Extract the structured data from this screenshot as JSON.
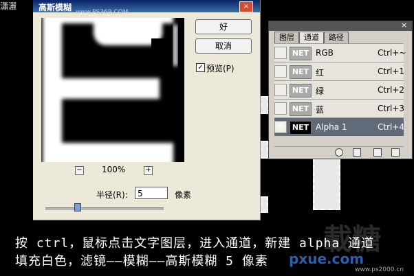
{
  "top_left_text": "瀟灑",
  "dialog": {
    "title": "高斯模糊",
    "title_watermark": "www.PS369.COM",
    "ok_label": "好",
    "cancel_label": "取消",
    "preview_label": "预览(P)",
    "preview_checked": true,
    "preview_checkmark": "✓",
    "zoom_minus": "−",
    "zoom_plus": "+",
    "zoom_value": "100%",
    "radius_label": "半径(R):",
    "radius_value": "5",
    "radius_unit": "像素",
    "close_glyph": "×",
    "slider_fraction": 0.27
  },
  "channels_panel": {
    "tabs": [
      "图层",
      "通道",
      "路径"
    ],
    "active_tab": 1,
    "close_glyph": "×",
    "rows": [
      {
        "thumb": "NET",
        "label": "RGB",
        "shortcut": "Ctrl+~",
        "visible": false,
        "selected": false
      },
      {
        "thumb": "NET",
        "label": "红",
        "shortcut": "Ctrl+1",
        "visible": false,
        "selected": false
      },
      {
        "thumb": "NET",
        "label": "绿",
        "shortcut": "Ctrl+2",
        "visible": false,
        "selected": false
      },
      {
        "thumb": "NET",
        "label": "蓝",
        "shortcut": "Ctrl+3",
        "visible": false,
        "selected": false
      },
      {
        "thumb": "NET",
        "label": "Alpha 1",
        "shortcut": "Ctrl+4",
        "visible": true,
        "selected": true
      }
    ],
    "eye_glyph": "👁"
  },
  "caption": {
    "line1": "按 ctrl，鼠标点击文字图层，进入通道，新建 alpha 通道",
    "line2": "填充白色，滤镜——模糊——高斯模糊 5 像素"
  },
  "watermark": {
    "big": "載糖",
    "site": "pxue.com",
    "small": "www.ps2000.cn"
  },
  "colors": {
    "accent": "#0a246a",
    "selected_row": "#606a78",
    "caption_text": "#ffffff"
  }
}
